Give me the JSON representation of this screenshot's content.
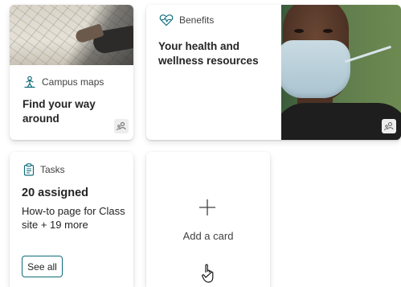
{
  "cards": {
    "campus_maps": {
      "header": "Campus maps",
      "title": "Find your way around",
      "icon": "person-map-icon"
    },
    "benefits": {
      "header": "Benefits",
      "title": "Your health and wellness resources",
      "icon": "heart-pulse-icon"
    },
    "tasks": {
      "header": "Tasks",
      "count": "20 assigned",
      "description": "How-to page for Class site + 19 more",
      "button": "See all",
      "icon": "clipboard-icon"
    },
    "add_card": {
      "label": "Add a card",
      "icon": "plus-icon"
    }
  },
  "colors": {
    "accent": "#0f6c7a",
    "text": "#242424"
  }
}
